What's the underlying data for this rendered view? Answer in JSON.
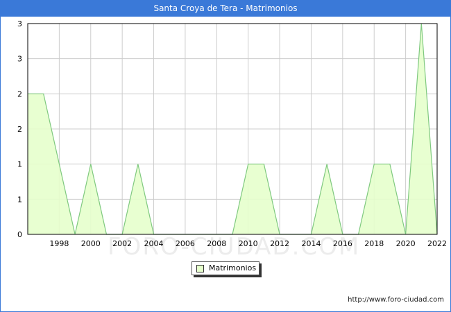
{
  "header": {
    "title": "Santa Croya de Tera - Matrimonios"
  },
  "credit": "http://www.foro-ciudad.com",
  "watermark": "FORO-CIUDAD.COM",
  "colors": {
    "title_bar": "#3a79d8",
    "area_fill": "#e6ffcc",
    "line": "#7fc97f",
    "grid": "#cccccc"
  },
  "chart_data": {
    "type": "area",
    "title": "Santa Croya de Tera - Matrimonios",
    "xlabel": "",
    "ylabel": "",
    "x": [
      1996,
      1997,
      1998,
      1999,
      2000,
      2001,
      2002,
      2003,
      2004,
      2005,
      2006,
      2007,
      2008,
      2009,
      2010,
      2011,
      2012,
      2013,
      2014,
      2015,
      2016,
      2017,
      2018,
      2019,
      2020,
      2021,
      2022
    ],
    "series": [
      {
        "name": "Matrimonios",
        "values": [
          2,
          2,
          1,
          0,
          1,
          0,
          0,
          1,
          0,
          0,
          0,
          0,
          0,
          0,
          1,
          1,
          0,
          0,
          0,
          1,
          0,
          0,
          1,
          1,
          0,
          3,
          0
        ]
      }
    ],
    "xlim": [
      1996,
      2022
    ],
    "ylim": [
      0,
      3
    ],
    "x_ticks": [
      "1998",
      "2000",
      "2002",
      "2004",
      "2006",
      "2008",
      "2010",
      "2012",
      "2014",
      "2016",
      "2018",
      "2020",
      "2022"
    ],
    "y_ticks": [
      "0",
      "1",
      "1",
      "2",
      "2",
      "3",
      "3"
    ],
    "grid": true,
    "legend": "bottom"
  }
}
